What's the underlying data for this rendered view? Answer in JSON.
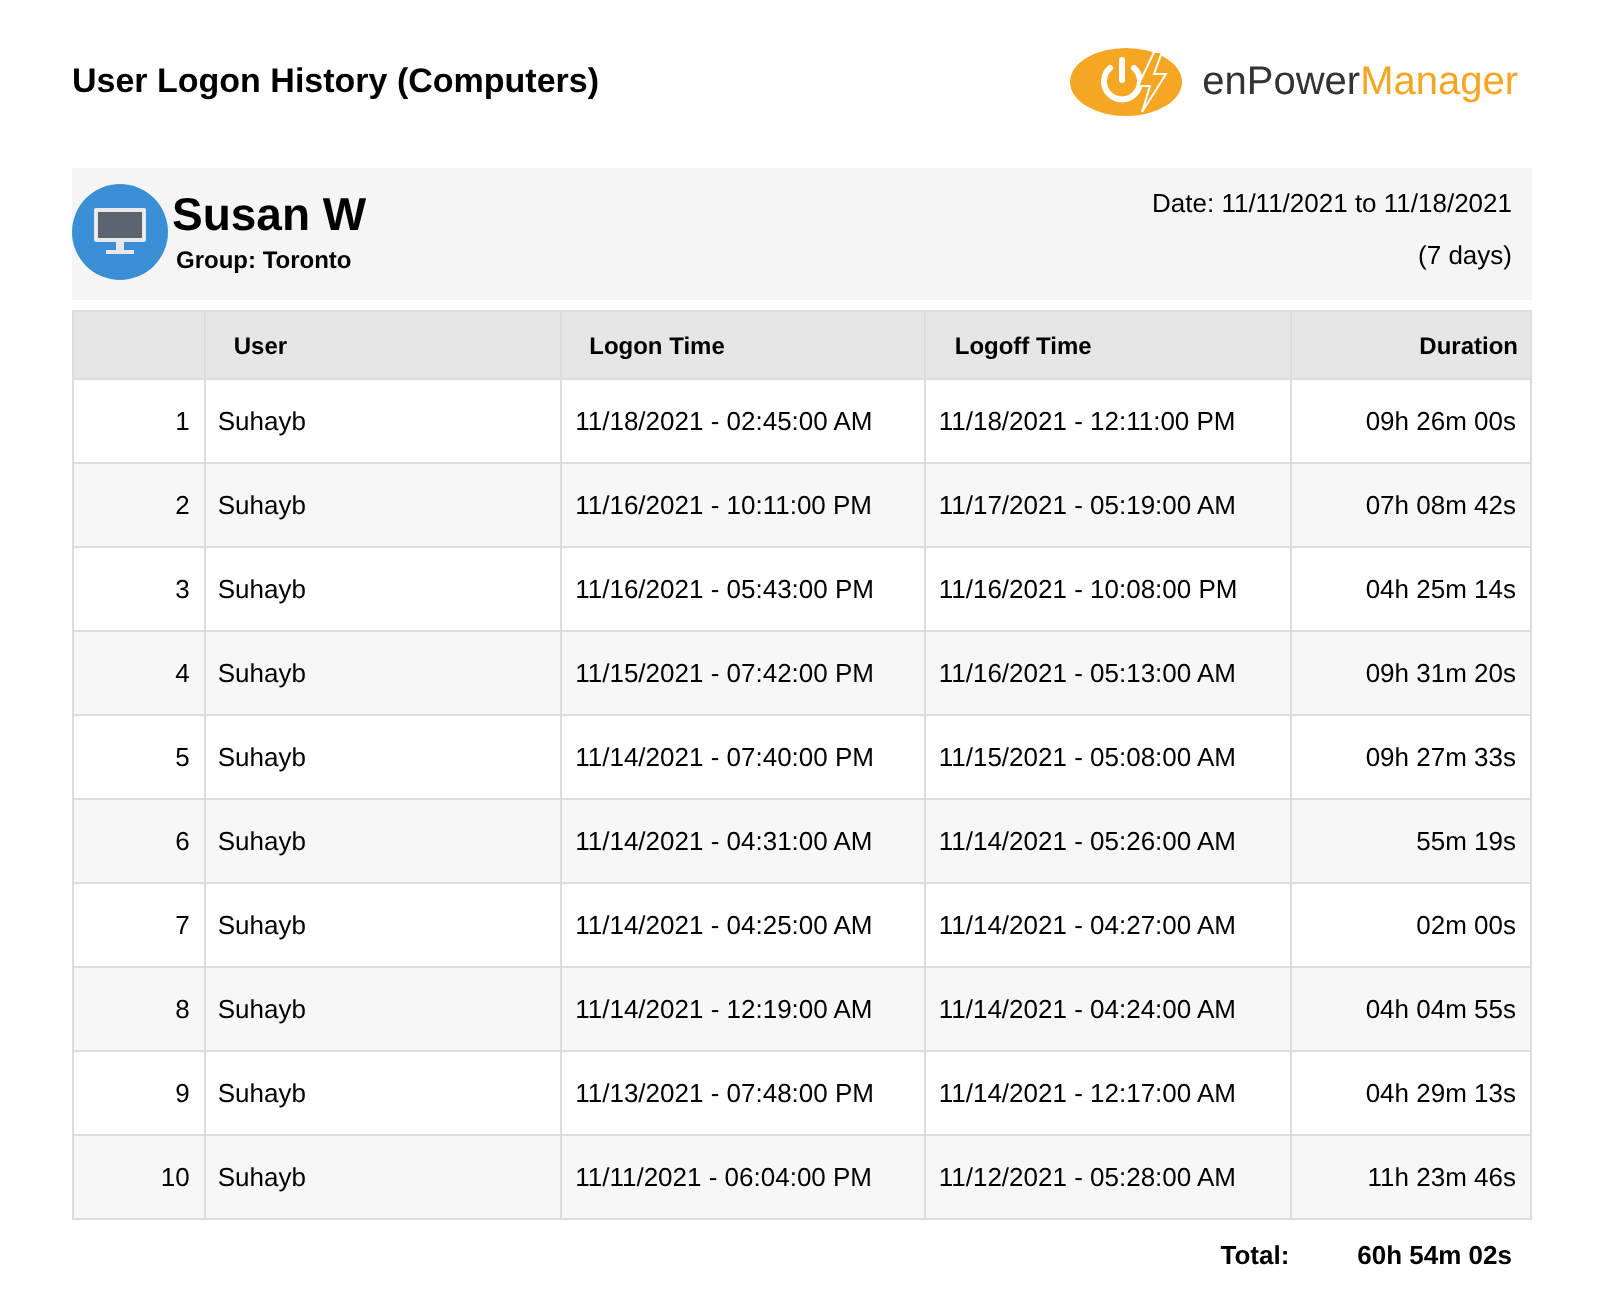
{
  "title": "User Logon History (Computers)",
  "logo": {
    "text_dark": "enPower",
    "text_accent": "Manager"
  },
  "computer": {
    "name": "Susan W",
    "group": "Group: Toronto",
    "date_range": "Date: 11/11/2021 to 11/18/2021",
    "days": "(7 days)"
  },
  "table": {
    "columns": [
      "User",
      "Logon Time",
      "Logoff Time",
      "Duration"
    ],
    "rows": [
      {
        "index": "1",
        "user": "Suhayb",
        "logon": "11/18/2021 - 02:45:00 AM",
        "logoff": "11/18/2021 - 12:11:00 PM",
        "duration": "09h 26m 00s"
      },
      {
        "index": "2",
        "user": "Suhayb",
        "logon": "11/16/2021 - 10:11:00 PM",
        "logoff": "11/17/2021 - 05:19:00 AM",
        "duration": "07h 08m 42s"
      },
      {
        "index": "3",
        "user": "Suhayb",
        "logon": "11/16/2021 - 05:43:00 PM",
        "logoff": "11/16/2021 - 10:08:00 PM",
        "duration": "04h 25m 14s"
      },
      {
        "index": "4",
        "user": "Suhayb",
        "logon": "11/15/2021 - 07:42:00 PM",
        "logoff": "11/16/2021 - 05:13:00 AM",
        "duration": "09h 31m 20s"
      },
      {
        "index": "5",
        "user": "Suhayb",
        "logon": "11/14/2021 - 07:40:00 PM",
        "logoff": "11/15/2021 - 05:08:00 AM",
        "duration": "09h 27m 33s"
      },
      {
        "index": "6",
        "user": "Suhayb",
        "logon": "11/14/2021 - 04:31:00 AM",
        "logoff": "11/14/2021 - 05:26:00 AM",
        "duration": "55m 19s"
      },
      {
        "index": "7",
        "user": "Suhayb",
        "logon": "11/14/2021 - 04:25:00 AM",
        "logoff": "11/14/2021 - 04:27:00 AM",
        "duration": "02m 00s"
      },
      {
        "index": "8",
        "user": "Suhayb",
        "logon": "11/14/2021 - 12:19:00 AM",
        "logoff": "11/14/2021 - 04:24:00 AM",
        "duration": "04h 04m 55s"
      },
      {
        "index": "9",
        "user": "Suhayb",
        "logon": "11/13/2021 - 07:48:00 PM",
        "logoff": "11/14/2021 - 12:17:00 AM",
        "duration": "04h 29m 13s"
      },
      {
        "index": "10",
        "user": "Suhayb",
        "logon": "11/11/2021 - 06:04:00 PM",
        "logoff": "11/12/2021 - 05:28:00 AM",
        "duration": "11h 23m 46s"
      }
    ]
  },
  "total": {
    "label": "Total:",
    "value": "60h 54m 02s"
  }
}
